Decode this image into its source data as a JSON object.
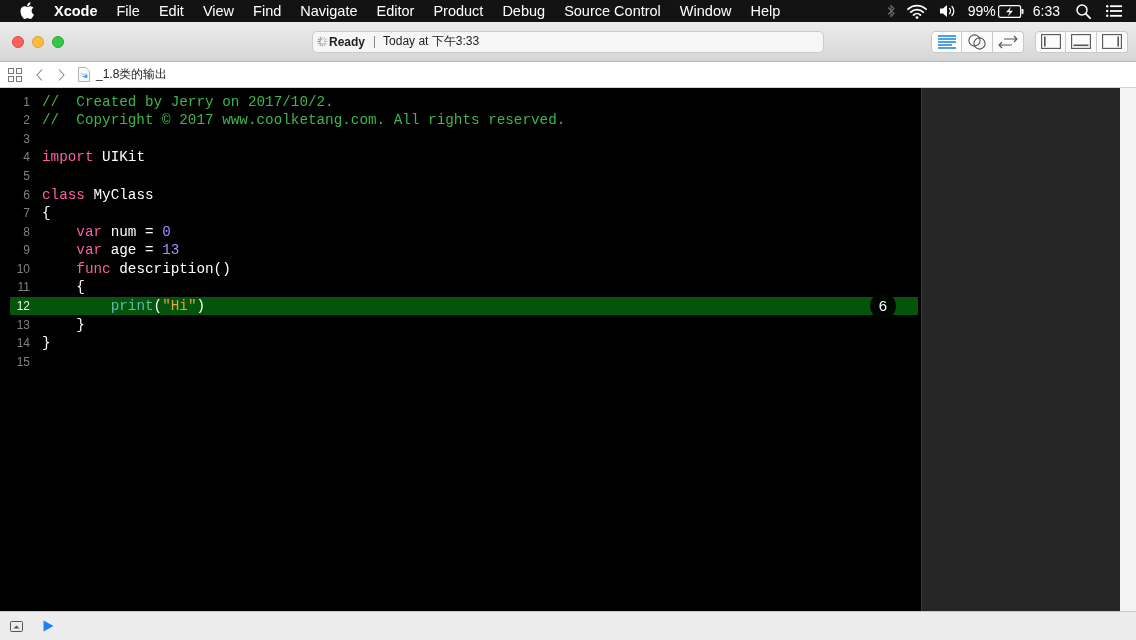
{
  "menu_bar": {
    "app_name": "Xcode",
    "menus": [
      "File",
      "Edit",
      "View",
      "Find",
      "Navigate",
      "Editor",
      "Product",
      "Debug",
      "Source Control",
      "Window",
      "Help"
    ],
    "battery": "99%",
    "clock": "6:33"
  },
  "toolbar": {
    "activity_status": "Ready",
    "activity_time": "Today at 下午3:33",
    "editor_modes": [
      {
        "kind": "standard",
        "selected": true
      },
      {
        "kind": "assistant",
        "selected": false
      },
      {
        "kind": "version",
        "selected": false
      }
    ],
    "panel_toggles": [
      {
        "kind": "navigator",
        "on": false
      },
      {
        "kind": "debug",
        "on": false
      },
      {
        "kind": "utilities",
        "on": false
      }
    ]
  },
  "jump_bar": {
    "file_name": "_1.8类的输出"
  },
  "editor": {
    "lines": [
      {
        "number": "1",
        "highlighted": false,
        "tokens": [
          {
            "kind": "comment",
            "text": "//  Created by Jerry on 2017/10/2."
          }
        ]
      },
      {
        "number": "2",
        "highlighted": false,
        "tokens": [
          {
            "kind": "comment",
            "text": "//  Copyright © 2017 www.coolketang.com. All rights reserved."
          }
        ]
      },
      {
        "number": "3",
        "highlighted": false
      },
      {
        "number": "4",
        "highlighted": false,
        "tokens": [
          {
            "kind": "keyword",
            "text": "import"
          },
          {
            "kind": "plain",
            "text": " UIKit"
          }
        ]
      },
      {
        "number": "5",
        "highlighted": false
      },
      {
        "number": "6",
        "highlighted": false,
        "tokens": [
          {
            "kind": "keyword",
            "text": "class"
          },
          {
            "kind": "plain",
            "text": " MyClass"
          }
        ]
      },
      {
        "number": "7",
        "highlighted": false,
        "tokens": [
          {
            "kind": "plain",
            "text": "{"
          }
        ]
      },
      {
        "number": "8",
        "highlighted": false,
        "tokens": [
          {
            "kind": "keyword",
            "text": "    var"
          },
          {
            "kind": "plain",
            "text": " num = "
          },
          {
            "kind": "number",
            "text": "0"
          }
        ]
      },
      {
        "number": "9",
        "highlighted": false,
        "tokens": [
          {
            "kind": "keyword",
            "text": "    var"
          },
          {
            "kind": "plain",
            "text": " age = "
          },
          {
            "kind": "number",
            "text": "13"
          }
        ]
      },
      {
        "number": "10",
        "highlighted": false,
        "tokens": [
          {
            "kind": "keyword",
            "text": "    func"
          },
          {
            "kind": "plain",
            "text": " description()"
          }
        ]
      },
      {
        "number": "11",
        "highlighted": false,
        "tokens": [
          {
            "kind": "plain",
            "text": "    {"
          }
        ]
      },
      {
        "number": "12",
        "highlighted": true,
        "badge": "6",
        "tokens": [
          {
            "kind": "function",
            "text": "        print"
          },
          {
            "kind": "plain",
            "text": "("
          },
          {
            "kind": "string",
            "text": "\"Hi\""
          },
          {
            "kind": "plain",
            "text": ")"
          }
        ]
      },
      {
        "number": "13",
        "highlighted": false,
        "tokens": [
          {
            "kind": "plain",
            "text": "    }"
          }
        ]
      },
      {
        "number": "14",
        "highlighted": false,
        "tokens": [
          {
            "kind": "plain",
            "text": "}"
          }
        ]
      },
      {
        "number": "15",
        "highlighted": false
      }
    ]
  }
}
